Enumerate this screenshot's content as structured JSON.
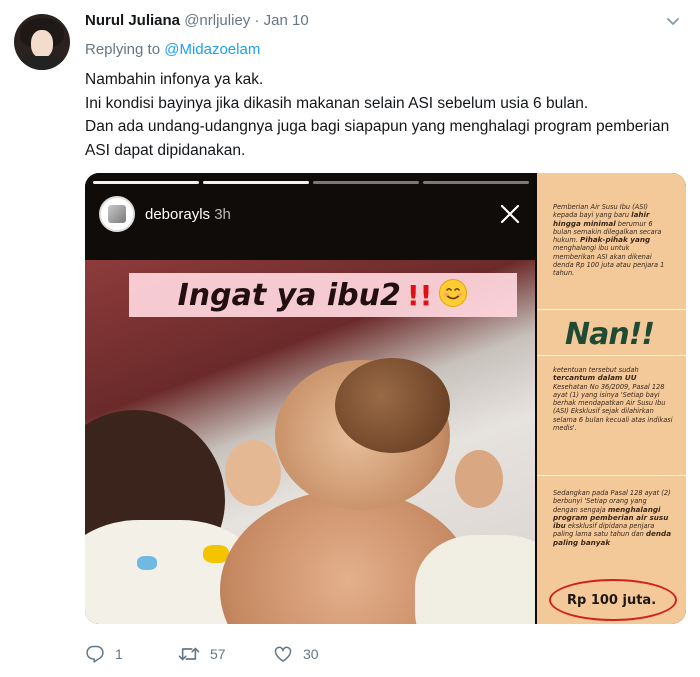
{
  "tweet": {
    "author_name": "Nurul Juliana",
    "handle": "@nrljuliey",
    "separator": "·",
    "date": "Jan 10",
    "replying_prefix": "Replying to",
    "replying_to": "@Midazoelam",
    "text_lines": [
      "Nambahin infonya ya kak.",
      "Ini kondisi bayinya jika dikasih makanan selain ASI sebelum usia 6 bulan.",
      "Dan ada undang-udangnya juga bagi siapapun yang menghalagi program pemberian ASI dapat dipidanakan."
    ]
  },
  "story": {
    "username": "deborayls",
    "time": "3h",
    "headline": "Ingat ya ibu2",
    "headline_marks": "!!",
    "emoji": "😊"
  },
  "sidebar_image": {
    "block1": {
      "intro": "Pemberian Air Susu Ibu (ASI) kepada bayi yang baru",
      "bold1": "lahir hingga minimal",
      "mid": "berumur 6 bulan semakin dilegalkan secara hukum.",
      "bold2": "Pihak-pihak yang",
      "rest": "menghalangi ibu untuk memberikan ASI akan dikenai denda Rp 100 juta atau penjara 1 tahun."
    },
    "big_text": "Nan!!",
    "block2": {
      "intro": "ketentuan tersebut sudah",
      "bold": "tercantum dalam UU",
      "rest": "Kesehatan No 36/2009, Pasal 128 ayat (1) yang isinya 'Setiap bayi berhak mendapatkan Air Susu Ibu (ASI) Eksklusif sejak dilahirkan selama 6 bulan kecuali atas indikasi medis'."
    },
    "block3": {
      "intro": "Sedangkan pada Pasal 128 ayat (2) berbunyi 'Setiap orang yang dengan sengaja",
      "bold": "menghalangi program pemberian air susu ibu",
      "mid": "eksklusif dipidana penjara paling lama satu tahun dan",
      "bold2": "denda paling banyak"
    },
    "price": "Rp 100 juta."
  },
  "actions": {
    "reply_count": "1",
    "retweet_count": "57",
    "like_count": "30"
  },
  "colors": {
    "accent": "#1da1f2",
    "muted": "#657786",
    "sidebar_bg": "#f3c99a"
  }
}
